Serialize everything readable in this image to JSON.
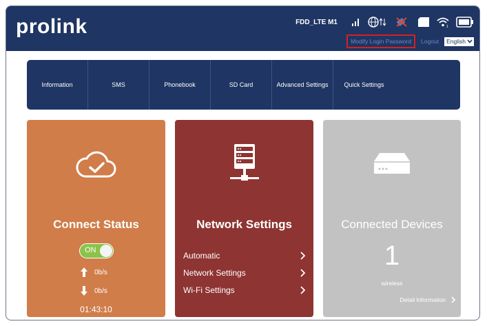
{
  "header": {
    "logo": "prolink",
    "carrier": "FDD_LTE M1",
    "icons": [
      "signal-icon",
      "globe-data-icon",
      "satellite-icon",
      "sim-card-icon",
      "wifi-icon",
      "battery-icon"
    ],
    "modify_password_label": "Modify Login Password",
    "logout_label": "Logout",
    "language": "English"
  },
  "nav": {
    "items": [
      {
        "label": "Information"
      },
      {
        "label": "SMS"
      },
      {
        "label": "Phonebook"
      },
      {
        "label": "SD Card"
      },
      {
        "label": "Advanced Settings"
      },
      {
        "label": "Quick Settings"
      }
    ]
  },
  "connect": {
    "title": "Connect Status",
    "toggle_label": "ON",
    "upload_rate": "0b/s",
    "download_rate": "0b/s",
    "uptime": "01:43:10"
  },
  "network": {
    "title": "Network Settings",
    "items": [
      {
        "label": "Automatic"
      },
      {
        "label": "Network Settings"
      },
      {
        "label": "Wi-Fi Settings"
      }
    ]
  },
  "devices": {
    "title": "Connected Devices",
    "count": "1",
    "type": "wireless",
    "detail_label": "Detail Information"
  },
  "colors": {
    "navy": "#1f3563",
    "orange": "#d07d4a",
    "red": "#8e3432",
    "gray": "#c2c2c2",
    "toggle_green": "#8bc34a",
    "highlight_red": "#d22222"
  }
}
